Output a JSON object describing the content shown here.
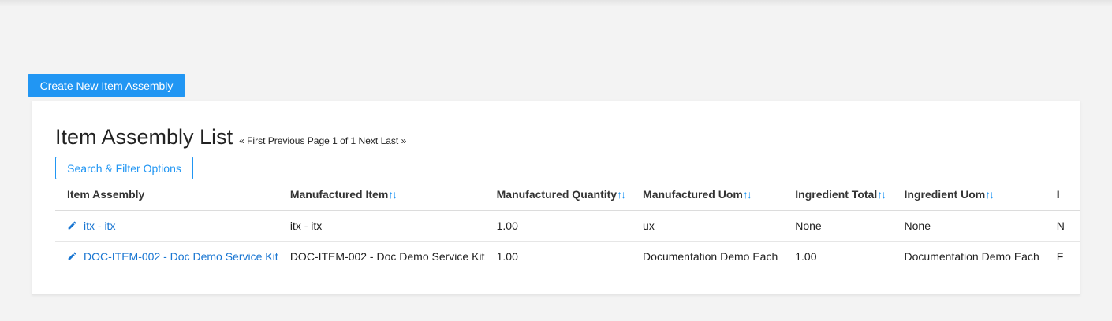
{
  "actions": {
    "create_label": "Create New Item Assembly"
  },
  "list": {
    "title": "Item Assembly List",
    "pager": {
      "first": "« First",
      "previous": "Previous",
      "page_info": "Page 1 of 1",
      "next": "Next",
      "last": "Last »"
    },
    "filter_label": "Search & Filter Options",
    "sort_glyph": "↑↓",
    "columns": [
      {
        "label": "Item Assembly",
        "sortable": false
      },
      {
        "label": "Manufactured Item",
        "sortable": true
      },
      {
        "label": "Manufactured Quantity",
        "sortable": true
      },
      {
        "label": "Manufactured Uom",
        "sortable": true
      },
      {
        "label": "Ingredient Total",
        "sortable": true
      },
      {
        "label": "Ingredient Uom",
        "sortable": true
      },
      {
        "label": "I",
        "sortable": false
      }
    ],
    "rows": [
      {
        "item_assembly": "itx - itx",
        "manufactured_item": "itx - itx",
        "manufactured_quantity": "1.00",
        "manufactured_uom": "ux",
        "ingredient_total": "None",
        "ingredient_uom": "None",
        "extra": "N"
      },
      {
        "item_assembly": "DOC-ITEM-002 - Doc Demo Service Kit",
        "manufactured_item": "DOC-ITEM-002 - Doc Demo Service Kit",
        "manufactured_quantity": "1.00",
        "manufactured_uom": "Documentation Demo Each",
        "ingredient_total": "1.00",
        "ingredient_uom": "Documentation Demo Each",
        "extra": "F"
      }
    ]
  },
  "colors": {
    "accent": "#2196f3",
    "link": "#1976d2",
    "background": "#f3f3f3"
  },
  "icons": {
    "edit": "pencil-icon"
  }
}
